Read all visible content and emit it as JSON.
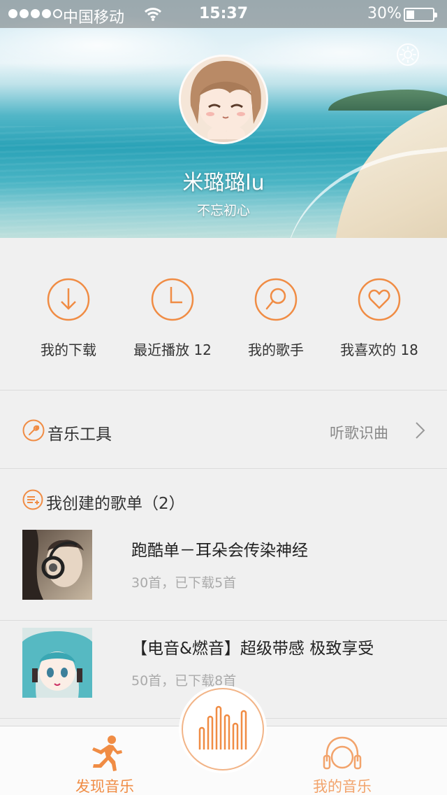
{
  "status_bar": {
    "carrier": "中国移动",
    "time": "15:37",
    "battery_percent": "30%",
    "battery_level": 0.3,
    "signal_bars_filled": 4,
    "signal_bars_total": 5
  },
  "profile": {
    "name": "米璐璐lu",
    "signature": "不忘初心"
  },
  "quick_actions": [
    {
      "label": "我的下载",
      "icon": "download-icon"
    },
    {
      "label": "最近播放 12",
      "icon": "clock-icon"
    },
    {
      "label": "我的歌手",
      "icon": "microphone-icon"
    },
    {
      "label": "我喜欢的 18",
      "icon": "heart-icon"
    }
  ],
  "tools": {
    "title": "音乐工具",
    "link": "听歌识曲"
  },
  "playlists": {
    "header": "我创建的歌单（2）",
    "items": [
      {
        "name": "跑酷单－耳朵会传染神经",
        "meta": "30首，已下载5首"
      },
      {
        "name": "【电音&燃音】超级带感 极致享受",
        "meta": "50首，已下载8首"
      }
    ]
  },
  "tab_bar": {
    "discover": "发现音乐",
    "my_music": "我的音乐"
  },
  "colors": {
    "accent": "#f08c44",
    "tab_active": "#f08c44",
    "tab_inactive": "#f2a36b"
  }
}
